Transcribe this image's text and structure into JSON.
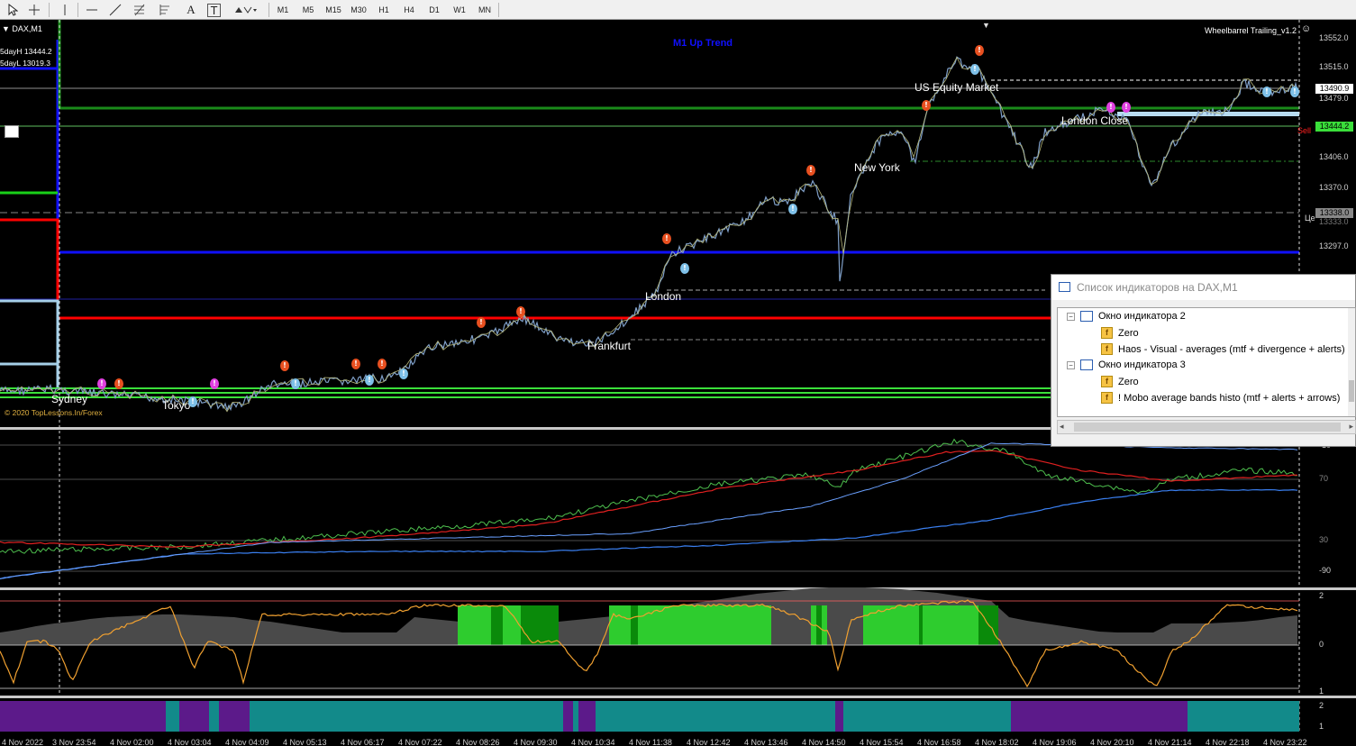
{
  "toolbar": {
    "timeframes": [
      "M1",
      "M5",
      "M15",
      "M30",
      "H1",
      "H4",
      "D1",
      "W1",
      "MN"
    ],
    "tools": [
      "cursor-icon",
      "crosshair-icon",
      "vertical-line-icon",
      "horizontal-line-icon",
      "trendline-icon",
      "fibonacci-icon",
      "fibonacci-fan-icon",
      "text-icon",
      "label-icon",
      "arrows-icon"
    ],
    "text_tool": "A",
    "label_tool": "T"
  },
  "chart": {
    "symbol": "DAX,M1",
    "five_day_high": "5dayH 13444.2",
    "five_day_low": "5dayL 13019.3",
    "trend_label": "M1 Up Trend",
    "ea_name": "Wheelbarrel Trailing_v1.2",
    "copyright": "© 2020 TopLessons.In/Forex",
    "sessions": [
      "Sydney",
      "Tokyo",
      "Frankfurt",
      "London",
      "New York",
      "US Equity Market",
      "London Close"
    ],
    "sell_label": "Sell",
    "ce_label": "Це",
    "price_ticks": [
      "13552.0",
      "13515.0",
      "13479.0",
      "13406.0",
      "13370.0",
      "13297.0"
    ],
    "current_price": "13490.9",
    "price_13444": "13444.2",
    "price_13338": "13338.0",
    "price_13333": "13333.0"
  },
  "osc1": {
    "ticks": [
      "2",
      "-10",
      "70",
      "30",
      "-90"
    ]
  },
  "osc2": {
    "ticks": [
      "2",
      "0",
      "1"
    ]
  },
  "osc3": {
    "ticks": [
      "2",
      "1"
    ]
  },
  "time_axis": [
    "4 Nov 2022",
    "3 Nov 23:54",
    "4 Nov 02:00",
    "4 Nov 03:04",
    "4 Nov 04:09",
    "4 Nov 05:13",
    "4 Nov 06:17",
    "4 Nov 07:22",
    "4 Nov 08:26",
    "4 Nov 09:30",
    "4 Nov 10:34",
    "4 Nov 11:38",
    "4 Nov 12:42",
    "4 Nov 13:46",
    "4 Nov 14:50",
    "4 Nov 15:54",
    "4 Nov 16:58",
    "4 Nov 18:02",
    "4 Nov 19:06",
    "4 Nov 20:10",
    "4 Nov 21:14",
    "4 Nov 22:18",
    "4 Nov 23:22"
  ],
  "indicator_window": {
    "title": "Список индикаторов на DAX,M1",
    "items": [
      {
        "label": "Окно индикатора 2",
        "kind": "window"
      },
      {
        "label": "Zero",
        "kind": "fx"
      },
      {
        "label": "Haos - Visual - averages (mtf + divergence + alerts)",
        "kind": "fx"
      },
      {
        "label": "Окно индикатора 3",
        "kind": "window"
      },
      {
        "label": "Zero",
        "kind": "fx"
      },
      {
        "label": "! Mobo average bands histo (mtf + alerts + arrows)",
        "kind": "fx"
      }
    ]
  }
}
